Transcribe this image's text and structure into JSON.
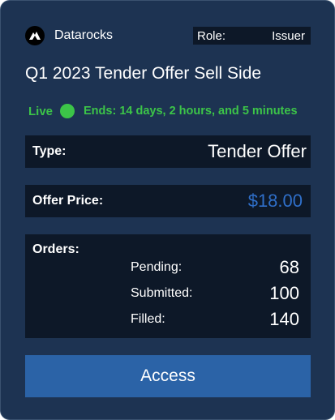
{
  "brand": {
    "name": "Datarocks",
    "logo_icon": "mountain-logo-icon"
  },
  "role": {
    "label": "Role:",
    "value": "Issuer"
  },
  "title": "Q1 2023 Tender Offer Sell Side",
  "status": {
    "live_label": "Live",
    "ends_text": "Ends: 14 days, 2 hours, and 5 minutes",
    "color": "#3cc448"
  },
  "type": {
    "label": "Type:",
    "value": "Tender Offer"
  },
  "offer_price": {
    "label": "Offer Price:",
    "value": "$18.00",
    "color": "#2f6fc9"
  },
  "orders": {
    "label": "Orders:",
    "items": [
      {
        "name": "Pending:",
        "count": "68"
      },
      {
        "name": "Submitted:",
        "count": "100"
      },
      {
        "name": "Filled:",
        "count": "140"
      }
    ]
  },
  "access_button": {
    "label": "Access",
    "color": "#2b63a7"
  },
  "colors": {
    "card_background": "#1d3352",
    "panel_background": "#0d1828"
  }
}
